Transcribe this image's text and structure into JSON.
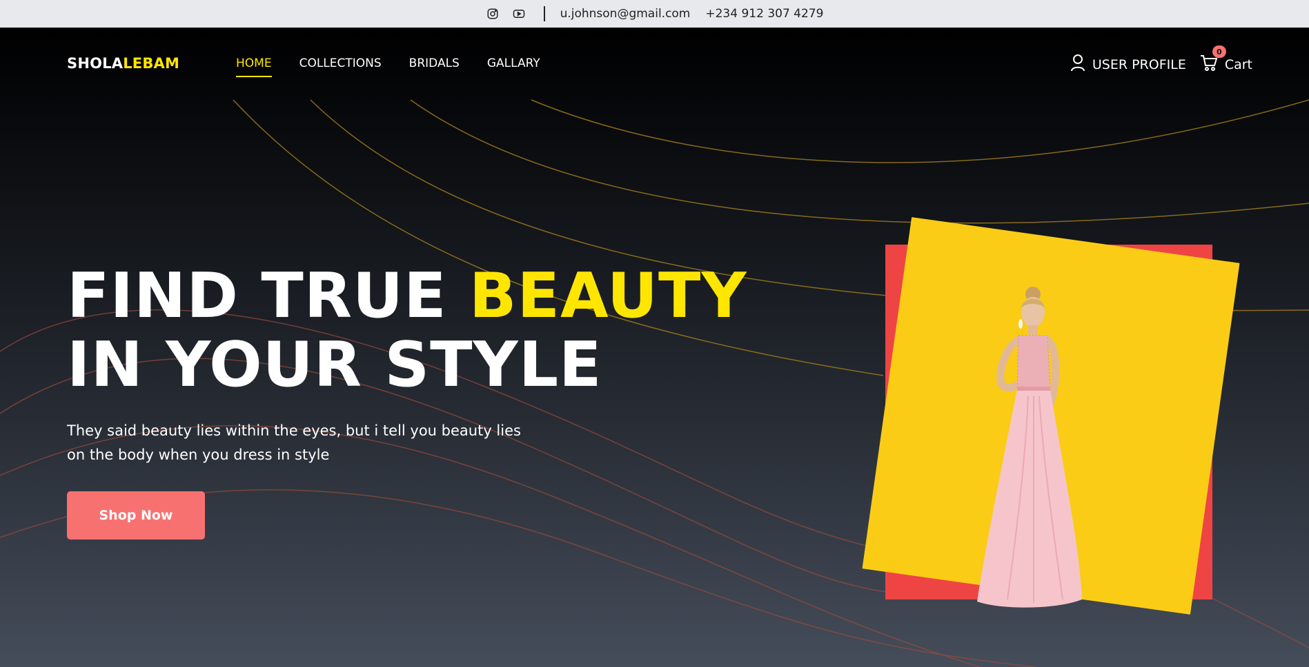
{
  "topbar": {
    "icons": [
      "instagram-icon",
      "youtube-icon"
    ],
    "email": "u.johnson@gmail.com",
    "phone": "+234 912 307 4279"
  },
  "nav": {
    "logo_part1": "SHOLA",
    "logo_part2": "LEBAM",
    "items": [
      {
        "label": "HOME",
        "active": true
      },
      {
        "label": "COLLECTIONS",
        "active": false
      },
      {
        "label": "BRIDALS",
        "active": false
      },
      {
        "label": "GALLARY",
        "active": false
      }
    ],
    "profile_label": "USER PROFILE",
    "cart_label": "Cart",
    "cart_count": "0"
  },
  "hero": {
    "headline_line1_white": "FIND TRUE ",
    "headline_line1_accent": "BEAUTY",
    "headline_line2": "IN YOUR STYLE",
    "subtext": "They said beauty lies within the eyes, but i tell you beauty lies on the body when you dress in style",
    "cta_label": "Shop Now"
  },
  "colors": {
    "accent": "#ffe600",
    "cta": "#f87171",
    "frame_red": "#ef4444",
    "card_yellow": "#facc15"
  }
}
